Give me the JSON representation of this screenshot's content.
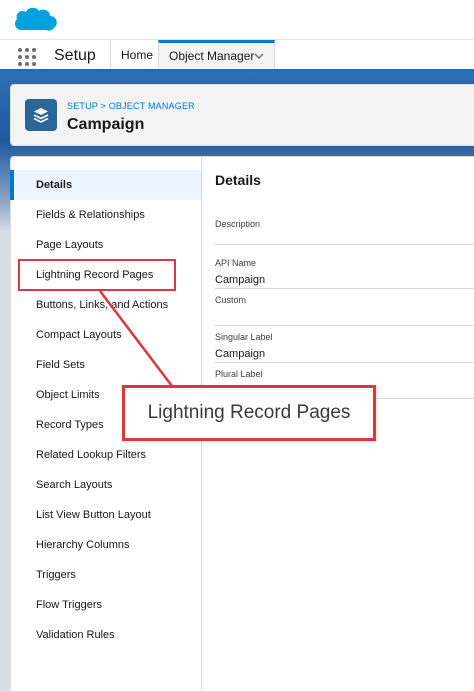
{
  "topbar": {
    "logo_icon": "salesforce-cloud-icon",
    "brand_color": "#00a1e0"
  },
  "nav": {
    "app_launcher_icon": "app-launcher-waffle-icon",
    "app_name": "Setup",
    "tabs": [
      {
        "label": "Home"
      },
      {
        "label": "Object Manager",
        "dropdown_icon": "chevron-down-icon",
        "active": true
      }
    ],
    "accent_color": "#0176d3"
  },
  "header": {
    "icon": "layers-icon",
    "breadcrumb": "SETUP > OBJECT MANAGER",
    "title": "Campaign"
  },
  "sidebar": {
    "items": [
      {
        "label": "Details",
        "active": true
      },
      {
        "label": "Fields & Relationships"
      },
      {
        "label": "Page Layouts"
      },
      {
        "label": "Lightning Record Pages"
      },
      {
        "label": "Buttons, Links, and Actions"
      },
      {
        "label": "Compact Layouts"
      },
      {
        "label": "Field Sets"
      },
      {
        "label": "Object Limits"
      },
      {
        "label": "Record Types"
      },
      {
        "label": "Related Lookup Filters"
      },
      {
        "label": "Search Layouts"
      },
      {
        "label": "List View Button Layout"
      },
      {
        "label": "Hierarchy Columns"
      },
      {
        "label": "Triggers"
      },
      {
        "label": "Flow Triggers"
      },
      {
        "label": "Validation Rules"
      }
    ]
  },
  "details": {
    "title": "Details",
    "fields": [
      {
        "label": "Description",
        "value": ""
      },
      {
        "label": "API Name",
        "value": "Campaign"
      },
      {
        "label": "Custom",
        "value": ""
      },
      {
        "label": "Singular Label",
        "value": "Campaign"
      },
      {
        "label": "Plural Label",
        "value": ""
      }
    ]
  },
  "annotation": {
    "callout_text": "Lightning Record Pages",
    "color": "#d9393e"
  }
}
